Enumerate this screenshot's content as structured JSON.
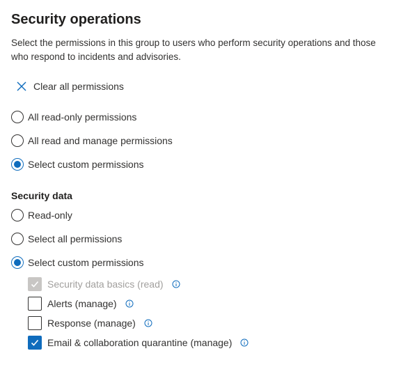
{
  "panel": {
    "title": "Security operations",
    "description": "Select the permissions in this group to users who perform security operations and those who respond to incidents and advisories.",
    "clear_label": "Clear all permissions"
  },
  "group_options": [
    {
      "label": "All read-only permissions",
      "checked": false
    },
    {
      "label": "All read and manage permissions",
      "checked": false
    },
    {
      "label": "Select custom permissions",
      "checked": true
    }
  ],
  "security_data": {
    "title": "Security data",
    "options": [
      {
        "label": "Read-only",
        "checked": false
      },
      {
        "label": "Select all permissions",
        "checked": false
      },
      {
        "label": "Select custom permissions",
        "checked": true
      }
    ],
    "permissions": [
      {
        "label": "Security data basics (read)",
        "checked": true,
        "disabled": true
      },
      {
        "label": "Alerts (manage)",
        "checked": false,
        "disabled": false
      },
      {
        "label": "Response (manage)",
        "checked": false,
        "disabled": false
      },
      {
        "label": "Email & collaboration quarantine (manage)",
        "checked": true,
        "disabled": false
      }
    ]
  },
  "colors": {
    "accent": "#0f6cbd",
    "text": "#323130",
    "disabled": "#c8c6c4"
  },
  "icons": {
    "clear": "close-icon",
    "info": "info-icon",
    "check": "checkmark-icon"
  }
}
